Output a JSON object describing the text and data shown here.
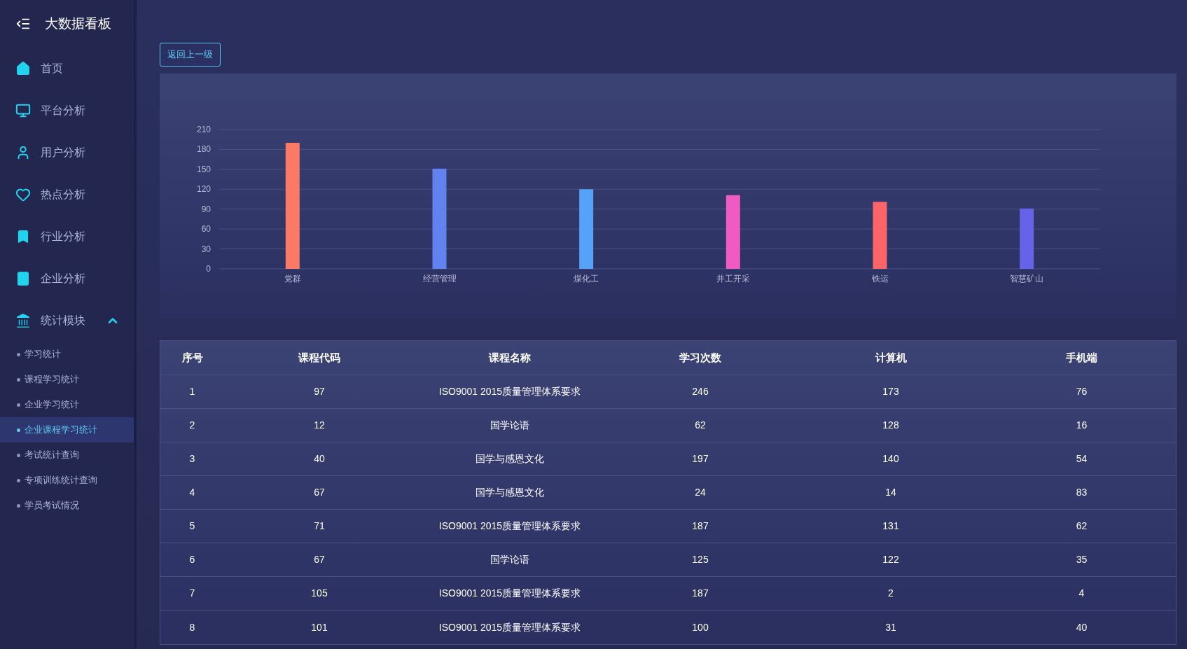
{
  "sidebar": {
    "title": "大数据看板",
    "items": [
      {
        "label": "首页"
      },
      {
        "label": "平台分析"
      },
      {
        "label": "用户分析"
      },
      {
        "label": "热点分析"
      },
      {
        "label": "行业分析"
      },
      {
        "label": "企业分析"
      },
      {
        "label": "统计模块",
        "expanded": true,
        "children": [
          {
            "label": "学习统计",
            "selected": false
          },
          {
            "label": "课程学习统计",
            "selected": false
          },
          {
            "label": "企业学习统计",
            "selected": false
          },
          {
            "label": "企业课程学习统计",
            "selected": true
          },
          {
            "label": "考试统计查询",
            "selected": false
          },
          {
            "label": "专项训练统计查询",
            "selected": false
          },
          {
            "label": "学员考试情况",
            "selected": false
          }
        ]
      }
    ]
  },
  "back_button": "返回上一级",
  "chart": {
    "chart_data": {
      "type": "bar",
      "categories": [
        "党群",
        "经营管理",
        "煤化工",
        "井工开采",
        "铁运",
        "智慧矿山"
      ],
      "values": [
        190,
        151,
        120,
        111,
        101,
        91
      ],
      "grid": true,
      "colors": [
        "#fb7a65",
        "#6282f0",
        "#55a2f7",
        "#f05ac3",
        "#fb6469",
        "#6763e8"
      ],
      "ylim": [
        0,
        210
      ],
      "yticks": [
        0,
        30,
        60,
        90,
        120,
        150,
        180,
        210
      ]
    }
  },
  "table": {
    "columns": [
      "序号",
      "课程代码",
      "课程名称",
      "学习次数",
      "计算机",
      "手机端"
    ],
    "rows": [
      [
        "1",
        "97",
        "ISO9001 2015质量管理体系要求",
        "246",
        "173",
        "76"
      ],
      [
        "2",
        "12",
        "国学论语",
        "62",
        "128",
        "16"
      ],
      [
        "3",
        "40",
        "国学与感恩文化",
        "197",
        "140",
        "54"
      ],
      [
        "4",
        "67",
        "国学与感恩文化",
        "24",
        "14",
        "83"
      ],
      [
        "5",
        "71",
        "ISO9001 2015质量管理体系要求",
        "187",
        "131",
        "62"
      ],
      [
        "6",
        "67",
        "国学论语",
        "125",
        "122",
        "35"
      ],
      [
        "7",
        "105",
        "ISO9001 2015质量管理体系要求",
        "187",
        "2",
        "4"
      ],
      [
        "8",
        "101",
        "ISO9001 2015质量管理体系要求",
        "100",
        "31",
        "40"
      ]
    ]
  }
}
